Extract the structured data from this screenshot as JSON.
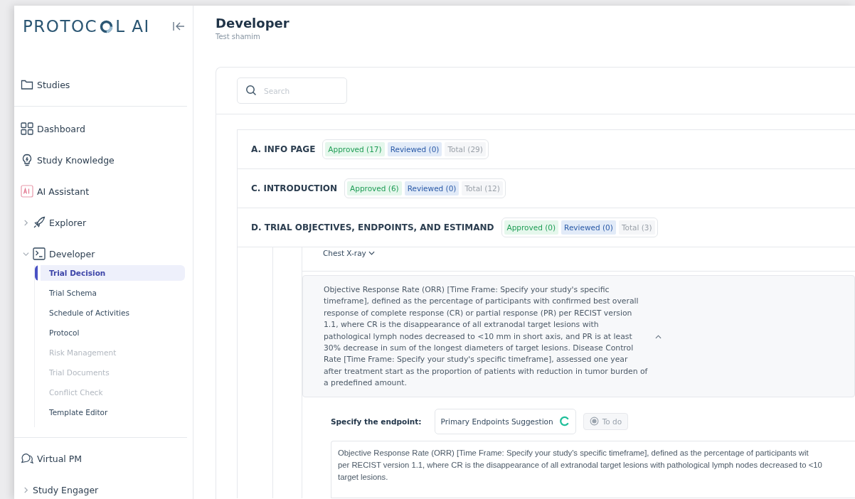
{
  "sidebar": {
    "logo": {
      "text_before": "PROTOC",
      "text_after": "L AI"
    },
    "sections": [
      [
        {
          "kind": "link",
          "label": "Studies"
        }
      ],
      [
        {
          "kind": "link",
          "label": "Dashboard"
        },
        {
          "kind": "link",
          "label": "Study Knowledge"
        },
        {
          "kind": "link",
          "label": "AI Assistant"
        },
        {
          "kind": "group",
          "label": "Explorer",
          "expanded": false
        },
        {
          "kind": "group",
          "label": "Developer",
          "expanded": true,
          "children": [
            {
              "label": "Trial Decision",
              "selected": true,
              "disabled": false
            },
            {
              "label": "Trial Schema",
              "selected": false,
              "disabled": false
            },
            {
              "label": "Schedule of Activities",
              "selected": false,
              "disabled": false
            },
            {
              "label": "Protocol",
              "selected": false,
              "disabled": false
            },
            {
              "label": "Risk Management",
              "selected": false,
              "disabled": true
            },
            {
              "label": "Trial Documents",
              "selected": false,
              "disabled": true
            },
            {
              "label": "Conflict Check",
              "selected": false,
              "disabled": true
            },
            {
              "label": "Template Editor",
              "selected": false,
              "disabled": false
            }
          ]
        }
      ],
      [
        {
          "kind": "link",
          "label": "Virtual PM"
        },
        {
          "kind": "group",
          "label": "Study Engager",
          "expanded": false
        }
      ]
    ]
  },
  "header": {
    "title": "Developer",
    "subtitle": "Test shamim"
  },
  "search": {
    "placeholder": "Search"
  },
  "sections": [
    {
      "title": "A. INFO PAGE",
      "badges": [
        {
          "kind": "approved",
          "label": "Approved (17)"
        },
        {
          "kind": "reviewed",
          "label": "Reviewed (0)"
        },
        {
          "kind": "total",
          "label": "Total (29)"
        }
      ]
    },
    {
      "title": "C. INTRODUCTION",
      "badges": [
        {
          "kind": "approved",
          "label": "Approved (6)"
        },
        {
          "kind": "reviewed",
          "label": "Reviewed (0)"
        },
        {
          "kind": "total",
          "label": "Total (12)"
        }
      ]
    },
    {
      "title": "D. TRIAL OBJECTIVES, ENDPOINTS, AND ESTIMAND",
      "badges": [
        {
          "kind": "approved",
          "label": "Approved (0)"
        },
        {
          "kind": "reviewed",
          "label": "Reviewed (0)"
        },
        {
          "kind": "total",
          "label": "Total (3)"
        }
      ]
    }
  ],
  "detail": {
    "dropdown_label": "Chest X-ray",
    "endpoint_text": "Objective Response Rate (ORR) [Time Frame: Specify your study's specific timeframe], defined as the percentage of participants with confirmed best overall response of complete response (CR) or partial response (PR) per RECIST version 1.1, where CR is the disappearance of all extranodal target lesions with pathological lymph nodes decreased to <10 mm in short axis, and PR is at least 30% decrease in sum of the longest diameters of target lesions. Disease Control Rate [Time Frame: Specify your study's specific timeframe], assessed one year after treatment start as the proportion of patients with reduction in tumor burden of a predefined amount.",
    "expanded": true,
    "field_label": "Specify the endpoint:",
    "suggestion_button": "Primary Endpoints Suggestion",
    "loading": true,
    "status_button": "To do",
    "textarea_lines": [
      "Objective Response Rate (ORR) [Time Frame: Specify your study's specific timeframe], defined as the percentage of participants wit",
      "per RECIST version 1.1, where CR is the disappearance of all extranodal target lesions with pathological lymph nodes decreased to <10",
      "target lesions."
    ]
  }
}
